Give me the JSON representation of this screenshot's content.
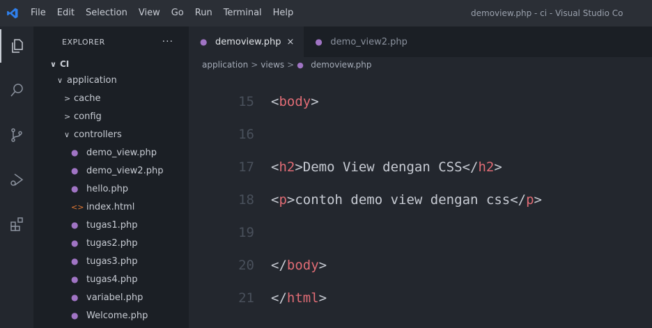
{
  "menu": {
    "items": [
      "File",
      "Edit",
      "Selection",
      "View",
      "Go",
      "Run",
      "Terminal",
      "Help"
    ],
    "window_title": "demoview.php - ci - Visual Studio Co"
  },
  "activity_bar": {
    "icons": [
      "explorer-icon",
      "search-icon",
      "source-control-icon",
      "run-debug-icon",
      "extensions-icon"
    ]
  },
  "sidebar": {
    "header": "EXPLORER",
    "more": "···",
    "root": "CI",
    "tree": [
      {
        "label": "application",
        "type": "folder",
        "expanded": true,
        "indent": 0
      },
      {
        "label": "cache",
        "type": "folder",
        "expanded": false,
        "indent": 1
      },
      {
        "label": "config",
        "type": "folder",
        "expanded": false,
        "indent": 1
      },
      {
        "label": "controllers",
        "type": "folder",
        "expanded": true,
        "indent": 1
      },
      {
        "label": "demo_view.php",
        "type": "php",
        "indent": 2
      },
      {
        "label": "demo_view2.php",
        "type": "php",
        "indent": 2
      },
      {
        "label": "hello.php",
        "type": "php",
        "indent": 2
      },
      {
        "label": "index.html",
        "type": "html",
        "indent": 2
      },
      {
        "label": "tugas1.php",
        "type": "php",
        "indent": 2
      },
      {
        "label": "tugas2.php",
        "type": "php",
        "indent": 2
      },
      {
        "label": "tugas3.php",
        "type": "php",
        "indent": 2
      },
      {
        "label": "tugas4.php",
        "type": "php",
        "indent": 2
      },
      {
        "label": "variabel.php",
        "type": "php",
        "indent": 2
      },
      {
        "label": "Welcome.php",
        "type": "php",
        "indent": 2
      }
    ]
  },
  "tabs": [
    {
      "label": "demoview.php",
      "active": true,
      "close": "×"
    },
    {
      "label": "demo_view2.php",
      "active": false
    }
  ],
  "breadcrumb": {
    "parts": [
      "application",
      "views",
      "demoview.php"
    ],
    "separator": ">"
  },
  "editor": {
    "lines": [
      {
        "num": "15",
        "tokens": [
          [
            "p",
            "<"
          ],
          [
            "t",
            "body"
          ],
          [
            "p",
            ">"
          ]
        ]
      },
      {
        "num": "16",
        "tokens": []
      },
      {
        "num": "17",
        "tokens": [
          [
            "p",
            "<"
          ],
          [
            "t",
            "h2"
          ],
          [
            "p",
            ">Demo View dengan CSS</"
          ],
          [
            "t",
            "h2"
          ],
          [
            "p",
            ">"
          ]
        ]
      },
      {
        "num": "18",
        "tokens": [
          [
            "p",
            "<"
          ],
          [
            "t",
            "p"
          ],
          [
            "p",
            ">contoh demo view dengan css</"
          ],
          [
            "t",
            "p"
          ],
          [
            "p",
            ">"
          ]
        ]
      },
      {
        "num": "19",
        "tokens": []
      },
      {
        "num": "20",
        "tokens": [
          [
            "p",
            "</"
          ],
          [
            "t",
            "body"
          ],
          [
            "p",
            ">"
          ]
        ]
      },
      {
        "num": "21",
        "tokens": [
          [
            "p",
            "</"
          ],
          [
            "t",
            "html"
          ],
          [
            "p",
            ">"
          ]
        ]
      }
    ]
  },
  "colors": {
    "accent": "#c8ccd4",
    "tag": "#e06c75",
    "php_icon": "#a074c4",
    "html_icon": "#e37933",
    "vscode_logo": "#2f80ed"
  }
}
